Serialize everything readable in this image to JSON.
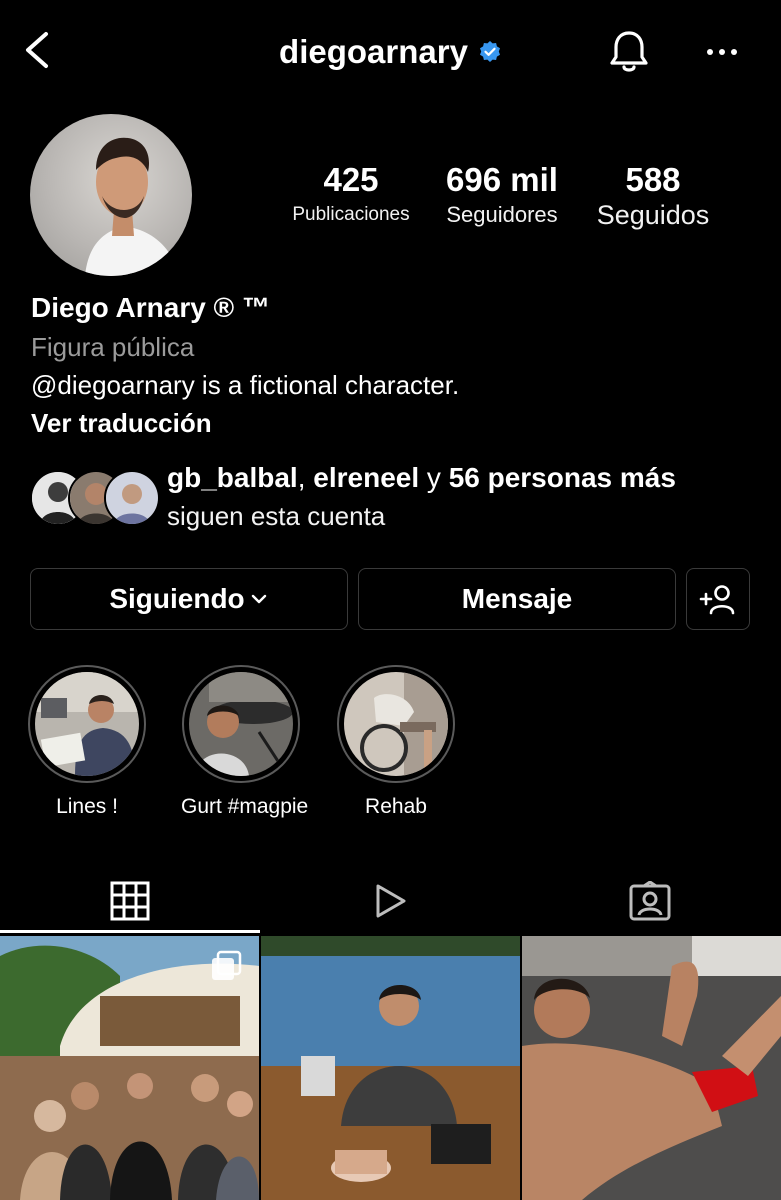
{
  "header": {
    "username": "diegoarnary",
    "icons": [
      "back-arrow-icon",
      "verified-badge-icon",
      "bell-icon",
      "more-options-icon"
    ]
  },
  "stats": [
    {
      "value": "425",
      "label": "Publicaciones"
    },
    {
      "value": "696 mil",
      "label": "Seguidores"
    },
    {
      "value": "588",
      "label": "Seguidos"
    }
  ],
  "profile": {
    "name": "Diego Arnary ® ™",
    "category": "Figura pública",
    "bio": "@diegoarnary is a fictional character.",
    "translate_link": "Ver traducción"
  },
  "followed_by": {
    "user1": "gb_balbal",
    "separator": ", ",
    "user2": "elreneel",
    "conjunction": " y ",
    "others": "56 personas más",
    "line2": "siguen esta cuenta"
  },
  "actions": {
    "following_label": "Siguiendo",
    "message_label": "Mensaje"
  },
  "highlights": [
    {
      "label": "Lines !"
    },
    {
      "label": "Gurt #magpie"
    },
    {
      "label": "Rehab"
    }
  ],
  "tabs": [
    "grid-icon",
    "reels-icon",
    "tagged-icon"
  ],
  "colors": {
    "background": "#000000",
    "text": "#ffffff",
    "secondary_text": "#9b9b9b",
    "verified_blue": "#3897f0",
    "button_border": "#3a3a3a"
  }
}
